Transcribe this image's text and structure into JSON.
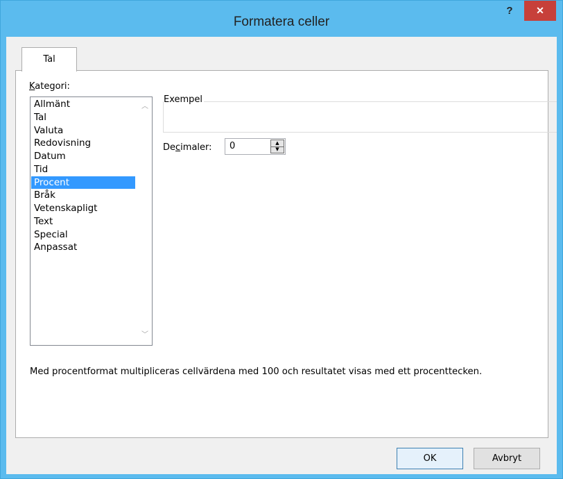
{
  "window": {
    "title": "Formatera celler",
    "help": "?",
    "close": "✕"
  },
  "tabs": [
    {
      "label": "Tal",
      "active": true
    }
  ],
  "category": {
    "label_prefix": "",
    "label_accel": "K",
    "label_rest": "ategori:",
    "items": [
      "Allmänt",
      "Tal",
      "Valuta",
      "Redovisning",
      "Datum",
      "Tid",
      "Procent",
      "Bråk",
      "Vetenskapligt",
      "Text",
      "Special",
      "Anpassat"
    ],
    "selected": "Procent"
  },
  "example": {
    "legend": "Exempel",
    "value": ""
  },
  "decimals": {
    "label_prefix": "De",
    "label_accel": "c",
    "label_rest": "imaler:",
    "value": "0"
  },
  "description": "Med procentformat multipliceras cellvärdena med 100 och resultatet visas med ett procenttecken.",
  "buttons": {
    "ok": "OK",
    "cancel": "Avbryt"
  },
  "icons": {
    "scroll_up": "chevron-up-icon",
    "scroll_down": "chevron-down-icon",
    "spin_up": "triangle-up-icon",
    "spin_down": "triangle-down-icon"
  },
  "colors": {
    "titlebar": "#5bbbee",
    "close_button": "#c7403a",
    "selection": "#3399ff"
  }
}
